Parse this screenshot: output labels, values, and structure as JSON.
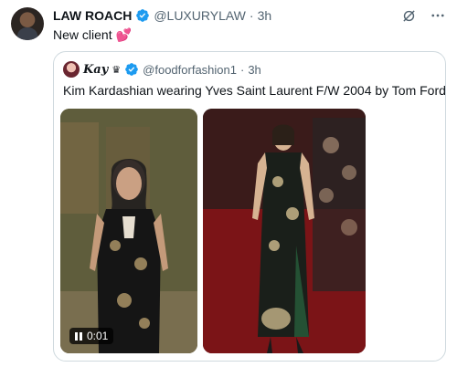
{
  "tweet": {
    "author_name": "LAW ROACH",
    "handle": "@LUXURYLAW",
    "dot": "·",
    "time": "3h",
    "text": "New client",
    "emoji": "💕"
  },
  "quoted": {
    "author_name": "Kay",
    "handle": "@foodforfashion1",
    "dot": "·",
    "time": "3h",
    "text": "Kim Kardashian wearing Yves Saint Laurent F/W 2004 by Tom Ford",
    "video_time": "0:01"
  },
  "colors": {
    "verified_blue": "#1d9bf0",
    "text_secondary": "#536471",
    "border": "#cfd9de"
  },
  "icons": {
    "verified": "verified-badge-icon",
    "grok": "grok-icon",
    "more": "more-icon",
    "lips": "lips-emoji-icon",
    "pause": "pause-icon"
  }
}
